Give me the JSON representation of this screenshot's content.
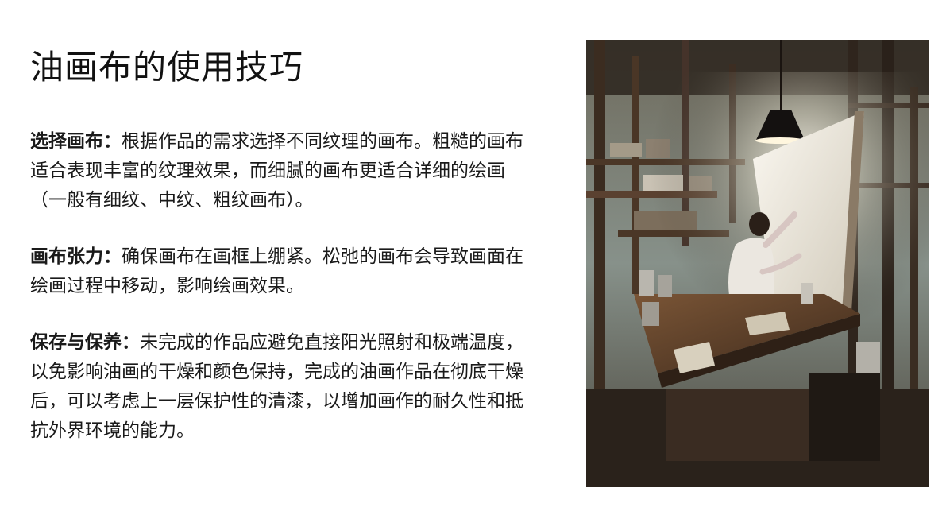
{
  "slide": {
    "title": "油画布的使用技巧"
  },
  "sections": [
    {
      "lead": "选择画布：",
      "body": "根据作品的需求选择不同纹理的画布。粗糙的画布适合表现丰富的纹理效果，而细腻的画布更适合详细的绘画（一般有细纹、中纹、粗纹画布）。"
    },
    {
      "lead": "画布张力：",
      "body": "确保画布在画框上绷紧。松弛的画布会导致画面在绘画过程中移动，影响绘画效果。"
    },
    {
      "lead": "保存与保养：",
      "body": "未完成的作品应避免直接阳光照射和极端温度，以免影响油画的干燥和颜色保持，完成的油画作品在彻底干燥后，可以考虑上一层保护性的清漆，以增加画作的耐久性和抵抗外界环境的能力。"
    }
  ],
  "artwork": {
    "subject": "painter-in-studio-illustration",
    "palette": {
      "wall": "#8f9a93",
      "wood": "#5a3f2a",
      "light": "#f4efe4",
      "shadow": "#231c16",
      "shirt": "#e9e6e1"
    }
  }
}
